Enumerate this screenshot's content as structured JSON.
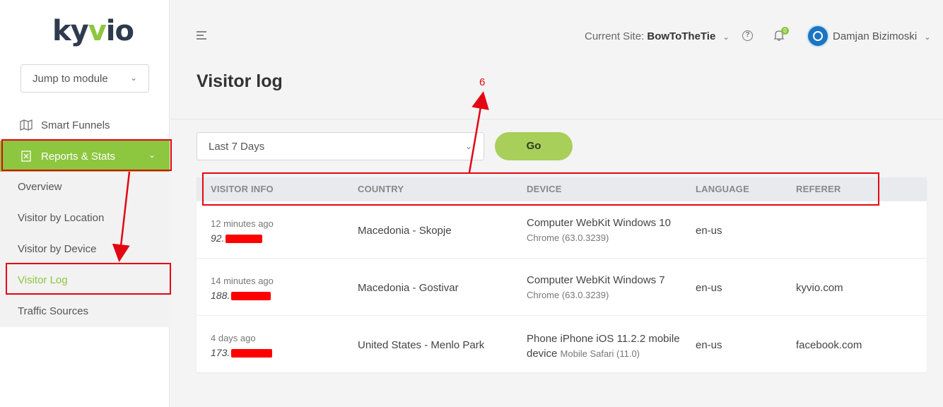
{
  "brand": {
    "logo_prefix": "ky",
    "logo_v": "v",
    "logo_suffix": "io"
  },
  "sidebar": {
    "jump_placeholder": "Jump to module",
    "items": [
      {
        "label": "Smart Funnels"
      },
      {
        "label": "Reports & Stats"
      }
    ],
    "sub_items": [
      {
        "label": "Overview"
      },
      {
        "label": "Visitor by Location"
      },
      {
        "label": "Visitor by Device"
      },
      {
        "label": "Visitor Log"
      },
      {
        "label": "Traffic Sources"
      }
    ]
  },
  "header": {
    "current_site_label": "Current Site:",
    "current_site_value": "BowToTheTie",
    "notifications_count": "0",
    "user_name": "Damjan Bizimoski"
  },
  "page": {
    "title": "Visitor log"
  },
  "filter": {
    "range": "Last 7 Days",
    "go_label": "Go"
  },
  "table": {
    "columns": [
      "VISITOR INFO",
      "COUNTRY",
      "DEVICE",
      "LANGUAGE",
      "REFERER"
    ],
    "rows": [
      {
        "time": "12 minutes ago",
        "ip": "92.",
        "country": "Macedonia - Skopje",
        "device": "Computer WebKit Windows 10",
        "browser": "Chrome (63.0.3239)",
        "language": "en-us",
        "referer": ""
      },
      {
        "time": "14 minutes ago",
        "ip": "188.",
        "country": "Macedonia - Gostivar",
        "device": "Computer WebKit Windows 7",
        "browser": "Chrome (63.0.3239)",
        "language": "en-us",
        "referer": "kyvio.com"
      },
      {
        "time": "4 days ago",
        "ip": "173.",
        "country": "United States - Menlo Park",
        "device": "Phone iPhone iOS 11.2.2 mobile device",
        "browser": "Mobile Safari (11.0)",
        "language": "en-us",
        "referer": "facebook.com"
      }
    ]
  },
  "annotation": {
    "label": "6",
    "color": "#e30613"
  },
  "colors": {
    "accent": "#8dc63f",
    "go_button": "#a8cf5a",
    "avatar": "#1a75c2"
  }
}
